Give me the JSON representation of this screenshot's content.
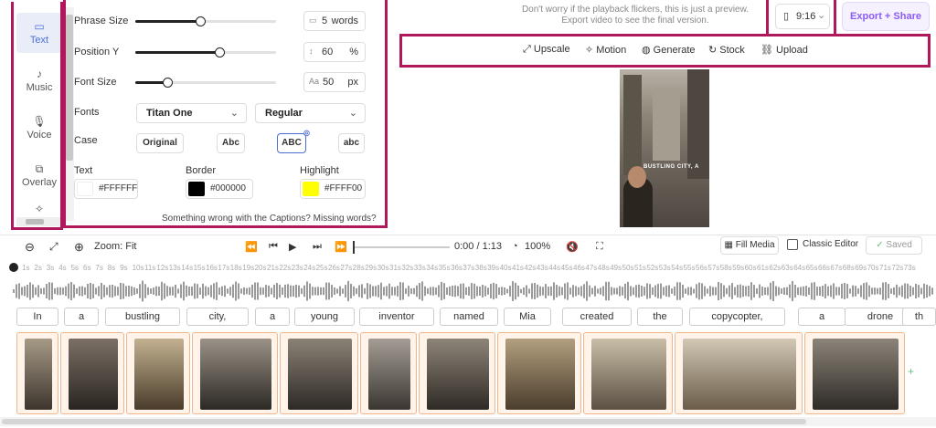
{
  "sidebar": {
    "items": [
      {
        "label": "Text",
        "icon": "text-icon"
      },
      {
        "label": "Music",
        "icon": "music-icon"
      },
      {
        "label": "Voice",
        "icon": "mic-icon"
      },
      {
        "label": "Overlay",
        "icon": "overlay-icon"
      }
    ]
  },
  "settings": {
    "phrase_size": {
      "label": "Phrase Size",
      "value": "5",
      "unit": "words",
      "fraction": 0.5
    },
    "position_y": {
      "label": "Position Y",
      "value": "60",
      "unit": "%",
      "fraction": 0.6
    },
    "font_size": {
      "label": "Font Size",
      "value": "50",
      "unit": "px",
      "fraction": 0.25
    },
    "fonts": {
      "label": "Fonts",
      "family": "Titan One",
      "weight": "Regular"
    },
    "case": {
      "label": "Case",
      "options": [
        "Original",
        "Abc",
        "ABC",
        "abc"
      ],
      "selected": "ABC"
    },
    "colors": {
      "text": {
        "label": "Text",
        "hex": "#FFFFFF"
      },
      "border": {
        "label": "Border",
        "hex": "#000000"
      },
      "highlight": {
        "label": "Highlight",
        "hex": "#FFFF00"
      }
    },
    "footer_note": "Something wrong with the Captions? Missing words?"
  },
  "preview": {
    "notice_line1": "Don't worry if the playback flickers, this is just a preview.",
    "notice_line2": "Export video to see the final version.",
    "ratio": "9:16",
    "export_label": "Export + Share",
    "toolbar": [
      "Upscale",
      "Motion",
      "Generate",
      "Stock",
      "Upload"
    ],
    "caption_text": "BUSTLING CITY, A"
  },
  "timeline": {
    "zoom_label": "Zoom: Fit",
    "time": "0:00 / 1:13",
    "speed": "100%",
    "fill_media": "Fill Media",
    "classic_editor": "Classic Editor",
    "saved": "Saved",
    "ruler": [
      "1s",
      "2s",
      "3s",
      "4s",
      "5s",
      "6s",
      "7s",
      "8s",
      "9s",
      "10s",
      "11s",
      "12s",
      "13s",
      "14s",
      "15s",
      "16s",
      "17s",
      "18s",
      "19s",
      "20s",
      "21s",
      "22s",
      "23s",
      "24s",
      "25s",
      "26s",
      "27s",
      "28s",
      "29s",
      "30s",
      "31s",
      "32s",
      "33s",
      "34s",
      "35s",
      "36s",
      "37s",
      "38s",
      "39s",
      "40s",
      "41s",
      "42s",
      "43s",
      "44s",
      "45s",
      "46s",
      "47s",
      "48s",
      "49s",
      "50s",
      "51s",
      "52s",
      "53s",
      "54s",
      "55s",
      "56s",
      "57s",
      "58s",
      "59s",
      "60s",
      "61s",
      "62s",
      "63s",
      "64s",
      "65s",
      "66s",
      "67s",
      "68s",
      "69s",
      "70s",
      "71s",
      "72s",
      "73s"
    ],
    "words": [
      "In",
      "a",
      "bustling",
      "city,",
      "a",
      "young",
      "inventor",
      "named",
      "Mia",
      "created",
      "the",
      "copycopter,",
      "a",
      "drone",
      "th"
    ]
  }
}
